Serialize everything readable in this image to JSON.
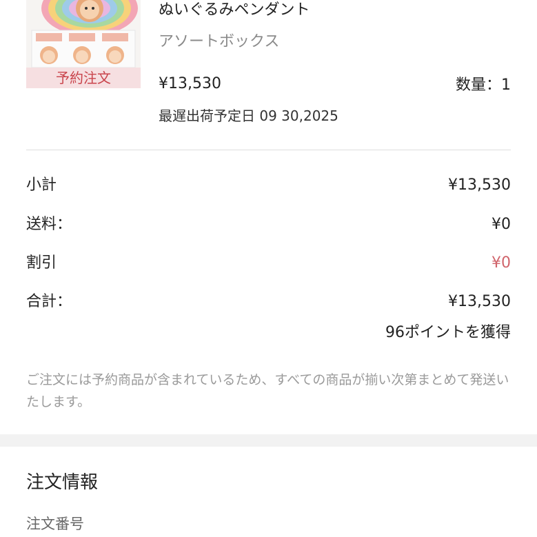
{
  "product": {
    "name": "ぬいぐるみペンダント",
    "variant": "アソートボックス",
    "price": "¥13,530",
    "quantity": "数量：1",
    "ship_date": "最遅出荷予定日 09 30,2025",
    "preorder_badge": "予約注文",
    "thumbnail_icon": "plush-figure-box-image"
  },
  "summary": {
    "subtotal_label": "小計",
    "subtotal_value": "¥13,530",
    "shipping_label": "送料：",
    "shipping_value": "¥0",
    "discount_label": "割引",
    "discount_value": "¥0",
    "total_label": "合計：",
    "total_value": "¥13,530",
    "points": "96ポイントを獲得"
  },
  "notice": "ご注文には予約商品が含まれているため、すべての商品が揃い次第まとめて発送いたします。",
  "order_info": {
    "title": "注文情報",
    "order_number_label": "注文番号"
  },
  "colors": {
    "accent_red": "#c9434b",
    "discount_red": "#d0646b",
    "badge_bg": "#f6dfe1",
    "muted_text": "#9a9a9a",
    "divider": "#dddddd",
    "section_band": "#f2f2f2"
  }
}
